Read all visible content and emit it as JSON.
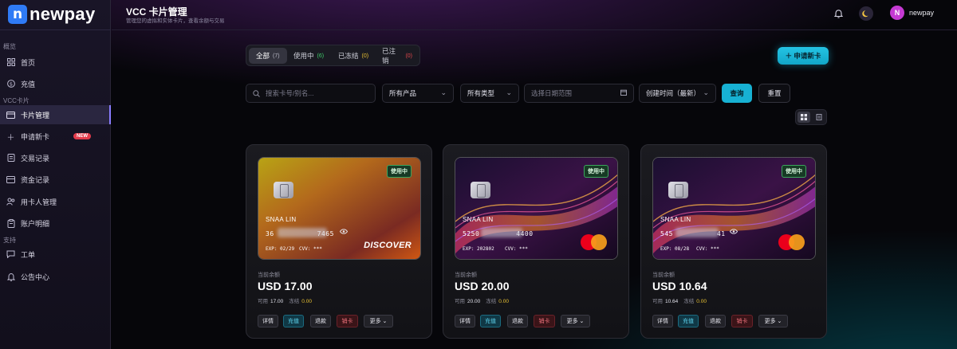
{
  "app": {
    "logo_letter": "n",
    "name": "newpay"
  },
  "sidebar": {
    "sections": [
      "概览",
      "VCC卡片",
      "支持"
    ],
    "items": [
      {
        "label": "首页",
        "icon": "dashboard-icon"
      },
      {
        "label": "充值",
        "icon": "dollar-icon"
      },
      {
        "label": "卡片管理",
        "icon": "card-icon",
        "active": true
      },
      {
        "label": "申请新卡",
        "icon": "plus-icon",
        "badge": "NEW"
      },
      {
        "label": "交易记录",
        "icon": "receipt-icon"
      },
      {
        "label": "资金记录",
        "icon": "wallet-icon"
      },
      {
        "label": "用卡人管理",
        "icon": "users-icon"
      },
      {
        "label": "账户明细",
        "icon": "clipboard-icon"
      },
      {
        "label": "工单",
        "icon": "chat-icon"
      },
      {
        "label": "公告中心",
        "icon": "bell-icon"
      }
    ]
  },
  "header": {
    "title": "VCC 卡片管理",
    "subtitle": "管理您的虚拟和实体卡片，查看余额与交易",
    "user": {
      "initial": "N",
      "name": "newpay"
    }
  },
  "tabs": [
    {
      "label": "全部",
      "count": "(7)",
      "color": "#b8b8c4",
      "active": true
    },
    {
      "label": "使用中",
      "count": "(6)",
      "color": "#3fcf6b"
    },
    {
      "label": "已冻结",
      "count": "(0)",
      "color": "#e9c233"
    },
    {
      "label": "已注销",
      "count": "(0)",
      "color": "#e5484d"
    }
  ],
  "apply_button": "＋ 申请新卡",
  "filters": {
    "search_placeholder": "搜索卡号/别名...",
    "product": "所有产品",
    "type": "所有类型",
    "date_placeholder": "选择日期范围",
    "sort": "创建时间（最新）",
    "query": "查询",
    "reset": "重置"
  },
  "cards": [
    {
      "status": "使用中",
      "holder": "SNAA LIN",
      "number_start": "36",
      "number_end": "7465",
      "exp": "EXP: 02/29",
      "cvv": "CVV: ***",
      "brand": "DISCOVER",
      "balance_label": "当前余额",
      "balance": "USD 17.00",
      "available_label": "可用",
      "available": "17.00",
      "frozen_label": "冻结",
      "frozen": "0.00",
      "actions": [
        "详情",
        "充值",
        "退款",
        "销卡",
        "更多 ⌄"
      ]
    },
    {
      "status": "使用中",
      "holder": "SNAA LIN",
      "number_start": "5250",
      "number_end": "4400",
      "exp": "EXP: 202802",
      "cvv": "CVV: ***",
      "brand": "mastercard",
      "balance_label": "当前余额",
      "balance": "USD 20.00",
      "available_label": "可用",
      "available": "20.00",
      "frozen_label": "冻结",
      "frozen": "0.00",
      "actions": [
        "详情",
        "充值",
        "退款",
        "销卡",
        "更多 ⌄"
      ]
    },
    {
      "status": "使用中",
      "holder": "SNAA LIN",
      "number_start": "545",
      "number_end": "41",
      "exp": "EXP: 08/28",
      "cvv": "CVV: ***",
      "brand": "mastercard",
      "balance_label": "当前余额",
      "balance": "USD 10.64",
      "available_label": "可用",
      "available": "10.64",
      "frozen_label": "冻结",
      "frozen": "0.00",
      "actions": [
        "详情",
        "充值",
        "退款",
        "销卡",
        "更多 ⌄"
      ]
    }
  ]
}
